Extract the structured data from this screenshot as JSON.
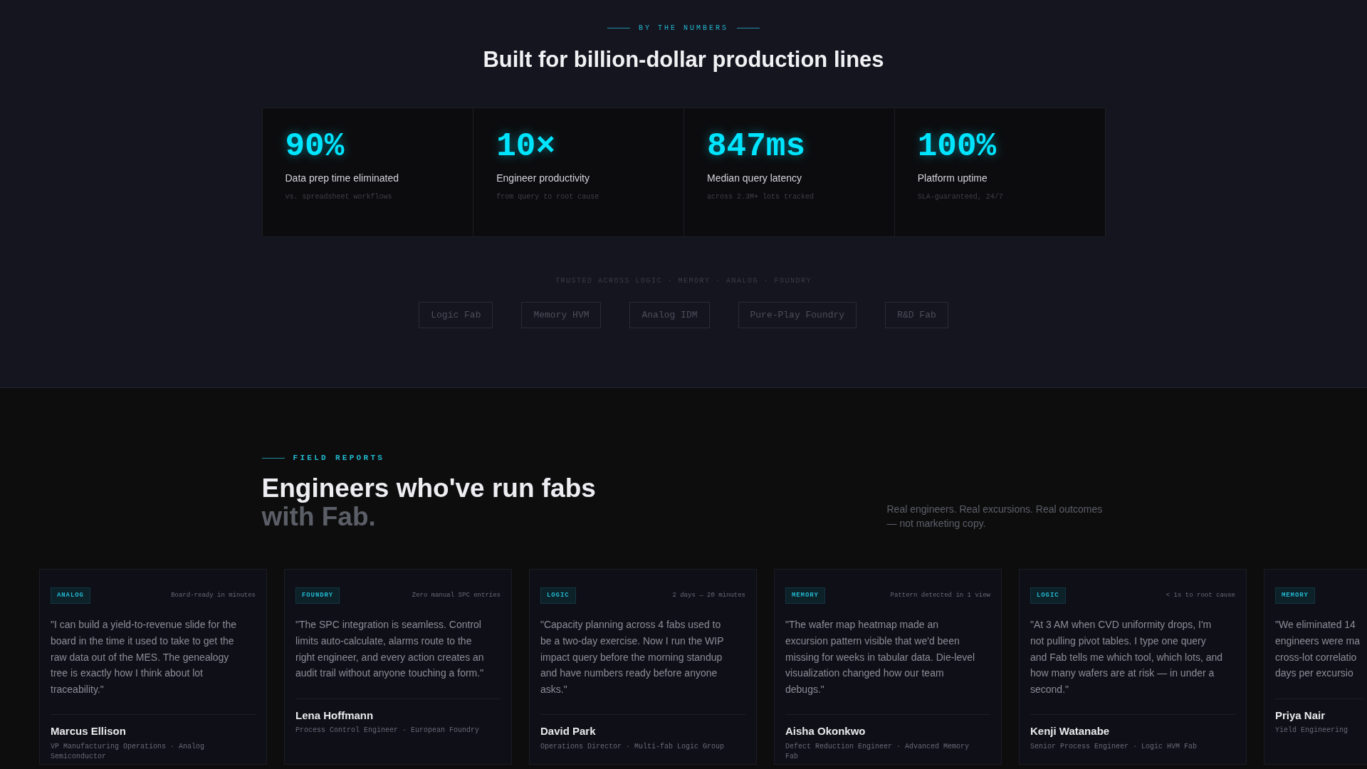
{
  "numbers": {
    "eyebrow": "BY THE NUMBERS",
    "title": "Built for billion-dollar production lines",
    "stats": [
      {
        "value": "90%",
        "label": "Data prep time eliminated",
        "note": "vs. spreadsheet workflows"
      },
      {
        "value": "10×",
        "label": "Engineer productivity",
        "note": "from query to root cause"
      },
      {
        "value": "847ms",
        "label": "Median query latency",
        "note": "across 2.3M+ lots tracked"
      },
      {
        "value": "100%",
        "label": "Platform uptime",
        "note": "SLA-guaranteed, 24/7"
      }
    ],
    "trusted_label": "TRUSTED ACROSS LOGIC · MEMORY · ANALOG · FOUNDRY",
    "segments": [
      "Logic Fab",
      "Memory HVM",
      "Analog IDM",
      "Pure-Play Foundry",
      "R&D Fab"
    ]
  },
  "field_reports": {
    "eyebrow": "FIELD REPORTS",
    "title": "Engineers who've run fabs",
    "title_muted": "with Fab.",
    "intro": "Real engineers. Real excursions. Real outcomes — not marketing copy.",
    "cards": [
      {
        "tag": "ANALOG",
        "outcome": "Board-ready in minutes",
        "quote": "\"I can build a yield-to-revenue slide for the board in the time it used to take to get the raw data out of the MES. The genealogy tree is exactly how I think about lot traceability.\"",
        "name": "Marcus Ellison",
        "role": "VP Manufacturing Operations · Analog Semiconductor"
      },
      {
        "tag": "FOUNDRY",
        "outcome": "Zero manual SPC entries",
        "quote": "\"The SPC integration is seamless. Control limits auto-calculate, alarms route to the right engineer, and every action creates an audit trail without anyone touching a form.\"",
        "name": "Lena Hoffmann",
        "role": "Process Control Engineer · European Foundry"
      },
      {
        "tag": "LOGIC",
        "outcome": "2 days → 20 minutes",
        "quote": "\"Capacity planning across 4 fabs used to be a two-day exercise. Now I run the WIP impact query before the morning standup and have numbers ready before anyone asks.\"",
        "name": "David Park",
        "role": "Operations Director · Multi-fab Logic Group"
      },
      {
        "tag": "MEMORY",
        "outcome": "Pattern detected in 1 view",
        "quote": "\"The wafer map heatmap made an excursion pattern visible that we'd been missing for weeks in tabular data. Die-level visualization changed how our team debugs.\"",
        "name": "Aisha Okonkwo",
        "role": "Defect Reduction Engineer · Advanced Memory Fab"
      },
      {
        "tag": "LOGIC",
        "outcome": "< 1s to root cause",
        "quote": "\"At 3 AM when CVD uniformity drops, I'm not pulling pivot tables. I type one query and Fab tells me which tool, which lots, and how many wafers are at risk — in under a second.\"",
        "name": "Kenji Watanabe",
        "role": "Senior Process Engineer · Logic HVM Fab"
      },
      {
        "tag": "MEMORY",
        "quote": "\"We eliminated 14\nengineers were ma\ncross-lot correlatio\ndays per excursio",
        "name": "Priya Nair",
        "role": "Yield Engineering"
      }
    ]
  }
}
